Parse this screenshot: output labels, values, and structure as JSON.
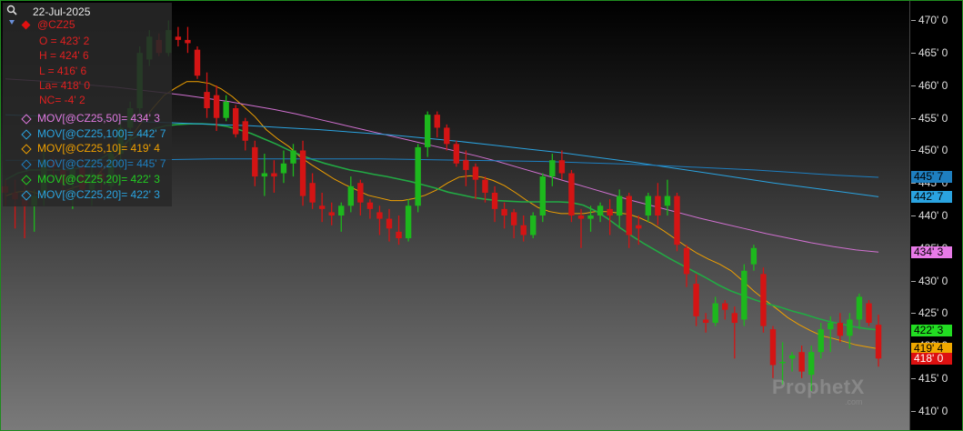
{
  "date_label": "22-Jul-2025",
  "symbol": "@CZ25",
  "ohlc": [
    {
      "text": "O = 423' 2"
    },
    {
      "text": "H = 424' 6"
    },
    {
      "text": "L = 416' 6"
    },
    {
      "text": "La= 418' 0"
    },
    {
      "text": "NC= -4' 2"
    }
  ],
  "indicators": [
    {
      "text": "MOV[@CZ25,50]= 434' 3",
      "color": "#e07ae0"
    },
    {
      "text": "MOV[@CZ25,100]= 442' 7",
      "color": "#2aa3e0"
    },
    {
      "text": "MOV[@CZ25,10]= 419' 4",
      "color": "#f0a000"
    },
    {
      "text": "MOV[@CZ25,200]= 445' 7",
      "color": "#1e7fc0"
    },
    {
      "text": "MOV[@CZ25,20]= 422' 3",
      "color": "#22cc22"
    },
    {
      "text": "MOV[@CZ25,20]= 422' 3",
      "color": "#2aa3e0"
    }
  ],
  "price_tags": [
    {
      "text": "445' 7",
      "value": 445.875,
      "bg": "#1e7fc0",
      "fg": "#000000"
    },
    {
      "text": "442' 7",
      "value": 442.875,
      "bg": "#2aa3e0",
      "fg": "#000000"
    },
    {
      "text": "434' 3",
      "value": 434.375,
      "bg": "#e87ae8",
      "fg": "#000000"
    },
    {
      "text": "422' 3",
      "value": 422.375,
      "bg": "#22dd22",
      "fg": "#000000"
    },
    {
      "text": "419' 4",
      "value": 419.5,
      "bg": "#f0a800",
      "fg": "#000000"
    },
    {
      "text": "418' 0",
      "value": 418.0,
      "bg": "#dd1111",
      "fg": "#ffffff"
    }
  ],
  "watermark": "ProphetX",
  "watermark_sub": ".com",
  "chart_data": {
    "type": "candlestick",
    "symbol": "@CZ25",
    "ylim": [
      407,
      473
    ],
    "yticks": [
      {
        "value": 410,
        "label": "410' 0"
      },
      {
        "value": 415,
        "label": "415' 0"
      },
      {
        "value": 420,
        "label": "420' 0"
      },
      {
        "value": 425,
        "label": "425' 0"
      },
      {
        "value": 430,
        "label": "430' 0"
      },
      {
        "value": 435,
        "label": "435' 0"
      },
      {
        "value": 440,
        "label": "440' 0"
      },
      {
        "value": 445,
        "label": "445' 0"
      },
      {
        "value": 450,
        "label": "450' 0"
      },
      {
        "value": 455,
        "label": "455' 0"
      },
      {
        "value": 460,
        "label": "460' 0"
      },
      {
        "value": 465,
        "label": "465' 0"
      },
      {
        "value": 470,
        "label": "470' 0"
      }
    ],
    "candles": [
      [
        444.5,
        445.5,
        441.5,
        443.5
      ],
      [
        443.5,
        445.5,
        438.0,
        442.5
      ],
      [
        442.5,
        446.0,
        436.5,
        441.5
      ],
      [
        441.5,
        444.0,
        437.5,
        443.0
      ],
      [
        443.5,
        450.0,
        441.5,
        448.5
      ],
      [
        448.5,
        449.0,
        446.0,
        447.5
      ],
      [
        447.0,
        449.0,
        443.5,
        445.0
      ],
      [
        445.5,
        448.0,
        441.0,
        447.0
      ],
      [
        447.5,
        449.0,
        443.0,
        444.0
      ],
      [
        444.0,
        448.0,
        441.5,
        446.5
      ],
      [
        446.5,
        447.5,
        442.5,
        445.5
      ],
      [
        444.5,
        450.0,
        444.0,
        449.5
      ],
      [
        449.5,
        454.5,
        447.0,
        453.5
      ],
      [
        453.5,
        457.5,
        450.5,
        456.5
      ],
      [
        456.5,
        466.0,
        455.5,
        465.0
      ],
      [
        464.0,
        468.5,
        463.0,
        467.5
      ],
      [
        467.0,
        468.0,
        464.5,
        465.0
      ],
      [
        465.0,
        470.0,
        464.5,
        468.5
      ],
      [
        467.5,
        469.0,
        466.0,
        467.0
      ],
      [
        467.0,
        469.0,
        465.0,
        466.5
      ],
      [
        465.5,
        466.0,
        461.0,
        461.5
      ],
      [
        459.0,
        462.0,
        455.0,
        456.5
      ],
      [
        458.5,
        460.0,
        453.0,
        455.0
      ],
      [
        455.0,
        458.5,
        454.5,
        457.5
      ],
      [
        456.5,
        457.0,
        452.0,
        452.5
      ],
      [
        454.5,
        455.0,
        450.0,
        451.5
      ],
      [
        450.5,
        451.5,
        444.5,
        446.0
      ],
      [
        446.0,
        449.5,
        443.0,
        446.5
      ],
      [
        446.5,
        448.5,
        443.5,
        446.0
      ],
      [
        446.5,
        450.0,
        445.0,
        448.0
      ],
      [
        448.0,
        451.0,
        446.0,
        450.0
      ],
      [
        450.0,
        451.5,
        441.5,
        443.0
      ],
      [
        445.0,
        446.5,
        441.0,
        442.0
      ],
      [
        441.5,
        443.5,
        439.0,
        441.0
      ],
      [
        440.5,
        442.0,
        438.5,
        440.0
      ],
      [
        440.0,
        442.0,
        437.5,
        441.5
      ],
      [
        441.5,
        446.0,
        440.5,
        444.5
      ],
      [
        445.0,
        445.5,
        440.0,
        442.0
      ],
      [
        442.0,
        442.5,
        439.5,
        441.0
      ],
      [
        440.5,
        441.5,
        437.0,
        439.5
      ],
      [
        439.5,
        441.0,
        436.0,
        438.0
      ],
      [
        437.5,
        440.0,
        435.5,
        436.5
      ],
      [
        436.5,
        442.5,
        436.0,
        441.5
      ],
      [
        441.5,
        451.0,
        440.5,
        450.5
      ],
      [
        450.5,
        456.0,
        449.0,
        455.5
      ],
      [
        455.5,
        456.0,
        452.0,
        453.5
      ],
      [
        453.5,
        454.0,
        450.0,
        451.0
      ],
      [
        451.0,
        451.5,
        447.5,
        448.0
      ],
      [
        448.5,
        450.0,
        444.5,
        447.0
      ],
      [
        447.5,
        448.0,
        442.5,
        445.5
      ],
      [
        445.5,
        446.0,
        442.0,
        443.5
      ],
      [
        443.5,
        444.5,
        439.0,
        441.0
      ],
      [
        441.0,
        442.0,
        438.0,
        440.0
      ],
      [
        440.5,
        441.0,
        436.5,
        438.5
      ],
      [
        438.5,
        440.0,
        436.0,
        437.0
      ],
      [
        437.0,
        440.5,
        436.5,
        440.0
      ],
      [
        440.0,
        446.5,
        439.0,
        446.0
      ],
      [
        446.0,
        449.5,
        444.5,
        448.5
      ],
      [
        448.5,
        450.0,
        445.5,
        446.5
      ],
      [
        446.5,
        447.0,
        439.0,
        440.0
      ],
      [
        440.0,
        441.0,
        435.0,
        439.5
      ],
      [
        439.5,
        441.5,
        437.5,
        440.0
      ],
      [
        440.0,
        442.0,
        439.0,
        441.5
      ],
      [
        441.0,
        442.5,
        437.0,
        440.0
      ],
      [
        440.0,
        444.0,
        438.0,
        443.0
      ],
      [
        443.0,
        443.5,
        435.0,
        437.0
      ],
      [
        438.5,
        440.0,
        435.5,
        438.0
      ],
      [
        440.0,
        443.5,
        439.0,
        443.0
      ],
      [
        443.0,
        445.0,
        438.5,
        440.0
      ],
      [
        441.5,
        445.5,
        440.0,
        443.0
      ],
      [
        443.0,
        443.5,
        434.5,
        435.5
      ],
      [
        435.0,
        435.5,
        429.0,
        431.0
      ],
      [
        429.5,
        431.0,
        423.0,
        424.5
      ],
      [
        424.0,
        425.0,
        422.0,
        423.5
      ],
      [
        423.5,
        427.5,
        423.0,
        426.5
      ],
      [
        426.5,
        427.0,
        424.0,
        425.5
      ],
      [
        425.0,
        426.0,
        418.0,
        423.5
      ],
      [
        424.0,
        432.5,
        423.0,
        431.5
      ],
      [
        432.5,
        435.5,
        431.5,
        435.0
      ],
      [
        431.0,
        432.0,
        422.0,
        423.0
      ],
      [
        422.5,
        423.0,
        415.0,
        417.0
      ],
      [
        417.5,
        420.5,
        414.0,
        417.5
      ],
      [
        418.0,
        419.0,
        416.0,
        418.5
      ],
      [
        419.0,
        420.0,
        415.0,
        416.0
      ],
      [
        415.5,
        420.0,
        413.0,
        419.0
      ],
      [
        419.0,
        423.5,
        418.0,
        422.5
      ],
      [
        422.5,
        424.5,
        419.0,
        423.5
      ],
      [
        423.5,
        425.0,
        420.5,
        421.5
      ],
      [
        421.5,
        425.0,
        419.5,
        424.0
      ],
      [
        424.0,
        428.0,
        422.5,
        427.5
      ],
      [
        426.5,
        427.0,
        423.0,
        423.5
      ],
      [
        423.2,
        424.75,
        416.75,
        418.0
      ]
    ],
    "series": [
      {
        "name": "MOV[@CZ25,10]",
        "color": "#f0a000",
        "values": [
          443.0,
          443.6,
          443.8,
          443.3,
          443.0,
          443.6,
          444.3,
          444.8,
          446.0,
          447.9,
          449.5,
          451.9,
          454.3,
          456.5,
          458.5,
          459.6,
          460.6,
          460.6,
          460.3,
          459.5,
          458.3,
          456.8,
          455.2,
          453.2,
          451.8,
          450.6,
          449.0,
          447.8,
          446.7,
          445.6,
          444.7,
          443.9,
          443.1,
          442.7,
          442.3,
          442.3,
          442.6,
          443.1,
          443.9,
          445.0,
          445.9,
          446.1,
          445.9,
          445.4,
          444.6,
          443.5,
          442.3,
          441.2,
          440.6,
          440.3,
          440.3,
          440.3,
          440.6,
          440.6,
          440.4,
          440.2,
          439.6,
          438.8,
          437.7,
          436.5,
          435.3,
          434.2,
          433.3,
          432.5,
          431.5,
          430.0,
          428.4,
          427.0,
          425.7,
          424.3,
          423.2,
          422.3,
          421.5,
          421.1,
          420.6,
          420.1,
          419.8,
          419.5
        ]
      },
      {
        "name": "MOV[@CZ25,20]",
        "color": "#22aa44",
        "values": [
          445.5,
          446.5,
          447.0,
          447.0,
          447.0,
          447.0,
          447.3,
          448.0,
          449.0,
          450.2,
          451.5,
          452.5,
          453.3,
          453.8,
          454.0,
          454.1,
          454.1,
          454.0,
          453.7,
          453.2,
          452.6,
          451.8,
          451.0,
          450.1,
          449.3,
          448.6,
          448.0,
          447.5,
          447.0,
          446.7,
          446.3,
          446.0,
          445.6,
          445.2,
          444.7,
          444.2,
          443.6,
          443.2,
          442.8,
          442.5,
          442.3,
          442.2,
          442.1,
          442.1,
          442.1,
          442.1,
          442.0,
          441.6,
          440.7,
          439.5,
          438.1,
          436.8,
          435.6,
          434.5,
          433.4,
          432.4,
          431.4,
          430.4,
          429.3,
          428.4,
          427.7,
          427.0,
          426.4,
          425.9,
          425.3,
          424.8,
          424.2,
          423.7,
          423.3,
          422.9,
          422.6,
          422.4
        ]
      },
      {
        "name": "MOV[@CZ25,50]",
        "color": "#d070d0",
        "values": [
          461.0,
          460.8,
          460.6,
          460.3,
          460.0,
          459.7,
          459.3,
          458.9,
          458.5,
          458.0,
          457.5,
          456.9,
          456.3,
          455.6,
          454.8,
          454.0,
          453.2,
          452.4,
          451.6,
          450.8,
          450.0,
          449.2,
          448.3,
          447.3,
          446.3,
          445.3,
          444.3,
          443.3,
          442.3,
          441.4,
          440.5,
          439.6,
          438.8,
          438.0,
          437.2,
          436.5,
          435.8,
          435.2,
          434.7,
          434.375
        ]
      },
      {
        "name": "MOV[@CZ25,100]",
        "color": "#2aa3e0",
        "values": [
          455.5,
          455.3,
          455.0,
          454.7,
          454.4,
          454.2,
          454.0,
          453.8,
          453.5,
          453.2,
          452.8,
          452.4,
          451.9,
          451.4,
          450.8,
          450.2,
          449.6,
          448.9,
          448.2,
          447.4,
          446.6,
          445.8,
          445.0,
          444.3,
          443.6,
          442.875
        ]
      },
      {
        "name": "MOV[@CZ25,200]",
        "color": "#1e7fc0",
        "values": [
          448.5,
          448.5,
          448.5,
          448.6,
          448.6,
          448.7,
          448.7,
          448.7,
          448.7,
          448.7,
          448.6,
          448.5,
          448.4,
          448.3,
          448.1,
          447.9,
          447.6,
          447.3,
          447.0,
          446.6,
          446.2,
          445.875
        ]
      }
    ]
  }
}
